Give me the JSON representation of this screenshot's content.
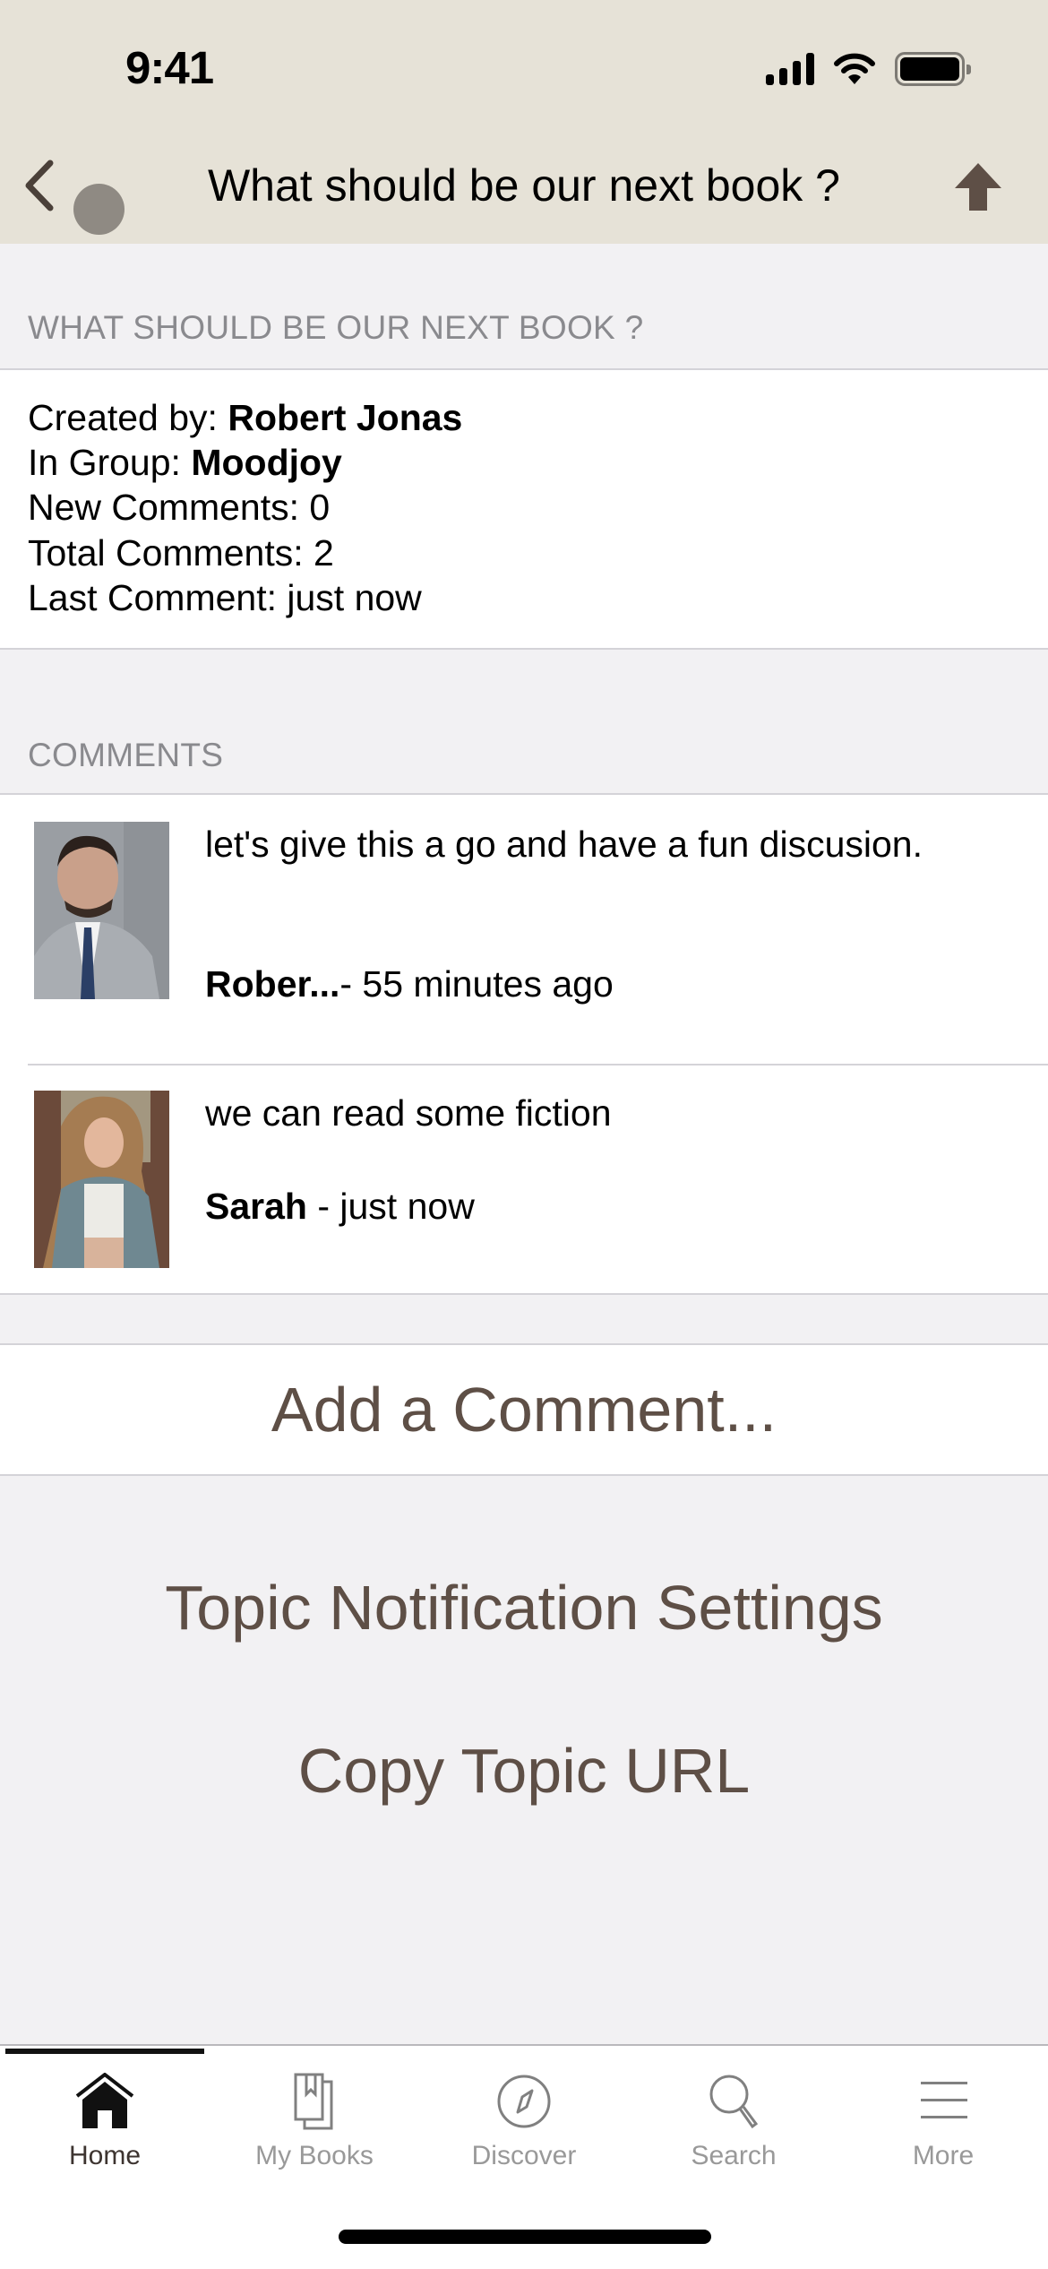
{
  "status_bar": {
    "time": "9:41",
    "icons": [
      "cellular-signal-icon",
      "wifi-icon",
      "battery-icon"
    ]
  },
  "nav": {
    "back_icon": "chevron-left-icon",
    "title": "What should be our next book ?",
    "right_icon": "arrow-up-icon"
  },
  "topic": {
    "section_label": "WHAT SHOULD BE OUR NEXT BOOK ?",
    "created_by_label": "Created by: ",
    "created_by": "Robert Jonas",
    "group_label": "In Group: ",
    "group": "Moodjoy",
    "new_comments": "New Comments: 0",
    "total_comments": "Total Comments: 2",
    "last_comment": "Last Comment: just now"
  },
  "comments": {
    "section_label": "COMMENTS",
    "items": [
      {
        "author": "Rober...",
        "separator": "- ",
        "time": "55 minutes ago",
        "text": "let's give this a go and have a fun discusion."
      },
      {
        "author": "Sarah",
        "separator": " - ",
        "time": "just now",
        "text": "we can read some fiction"
      }
    ]
  },
  "actions": {
    "add_comment": "Add a Comment...",
    "notification_settings": "Topic Notification Settings",
    "copy_url": "Copy Topic URL"
  },
  "tabs": [
    {
      "label": "Home",
      "icon": "home-icon",
      "active": true
    },
    {
      "label": "My Books",
      "icon": "books-icon",
      "active": false
    },
    {
      "label": "Discover",
      "icon": "compass-icon",
      "active": false
    },
    {
      "label": "Search",
      "icon": "search-icon",
      "active": false
    },
    {
      "label": "More",
      "icon": "menu-icon",
      "active": false
    }
  ],
  "colors": {
    "header_bg": "#E6E2D7",
    "accent_brown": "#5E4F46",
    "page_bg": "#F2F1F3",
    "section_label": "#8A8A8E",
    "tab_inactive": "#999999"
  }
}
